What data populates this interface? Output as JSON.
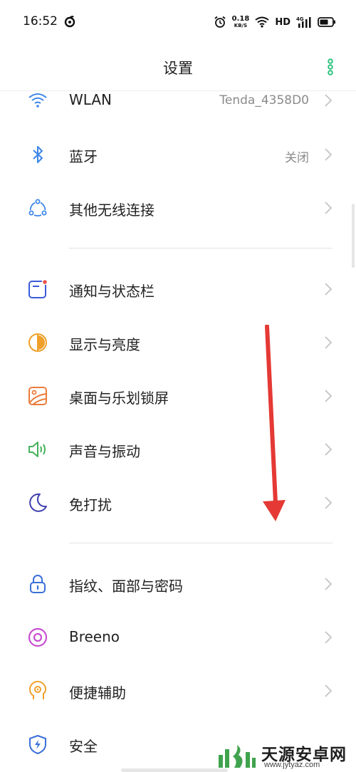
{
  "status_bar": {
    "time": "16:52",
    "net_speed_value": "0.18",
    "net_speed_unit": "KB/S",
    "hd_label": "HD",
    "signal_label": "4G"
  },
  "header": {
    "title": "设置",
    "more_icon": "more-vertical-icon"
  },
  "accent_color": "#2ec27e",
  "sections": [
    [
      {
        "label": "WLAN",
        "value": "Tenda_4358D0",
        "icon": "wifi-icon"
      },
      {
        "label": "蓝牙",
        "value": "关闭",
        "icon": "bluetooth-icon"
      },
      {
        "label": "其他无线连接",
        "value": "",
        "icon": "wireless-connections-icon"
      }
    ],
    [
      {
        "label": "通知与状态栏",
        "value": "",
        "icon": "notification-icon"
      },
      {
        "label": "显示与亮度",
        "value": "",
        "icon": "display-brightness-icon"
      },
      {
        "label": "桌面与乐划锁屏",
        "value": "",
        "icon": "wallpaper-icon"
      },
      {
        "label": "声音与振动",
        "value": "",
        "icon": "speaker-icon"
      },
      {
        "label": "免打扰",
        "value": "",
        "icon": "moon-icon"
      }
    ],
    [
      {
        "label": "指纹、面部与密码",
        "value": "",
        "icon": "lock-icon"
      },
      {
        "label": "Breeno",
        "value": "",
        "icon": "breeno-icon"
      },
      {
        "label": "便捷辅助",
        "value": "",
        "icon": "assist-head-icon"
      },
      {
        "label": "安全",
        "value": "",
        "icon": "security-shield-icon"
      }
    ]
  ],
  "watermark": {
    "text": "天源安卓网",
    "url": "www.jytyaz.com"
  }
}
